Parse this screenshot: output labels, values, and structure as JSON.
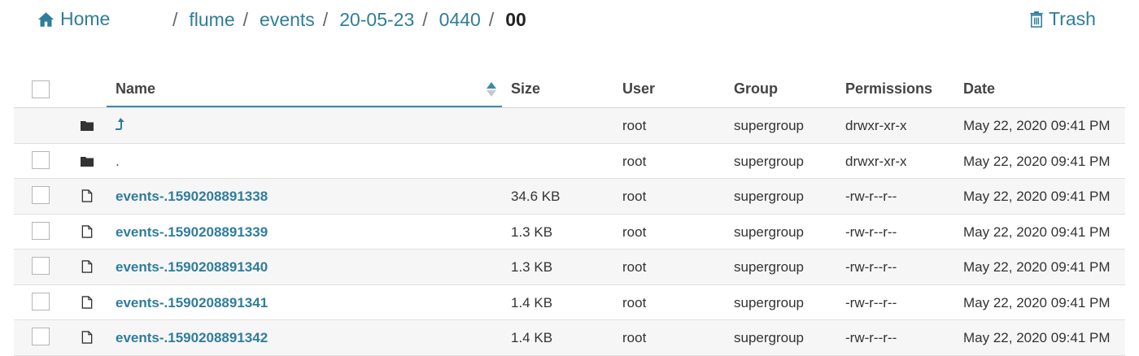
{
  "nav": {
    "home_label": "Home",
    "trash_label": "Trash",
    "breadcrumbs": [
      "flume",
      "events",
      "20-05-23",
      "0440",
      "00"
    ]
  },
  "table": {
    "headers": {
      "name": "Name",
      "size": "Size",
      "user": "User",
      "group": "Group",
      "permissions": "Permissions",
      "date": "Date"
    },
    "rows": [
      {
        "type": "parent",
        "name": "",
        "size": "",
        "user": "root",
        "group": "supergroup",
        "permissions": "drwxr-xr-x",
        "date": "May 22, 2020 09:41 PM"
      },
      {
        "type": "folder",
        "name": ".",
        "size": "",
        "user": "root",
        "group": "supergroup",
        "permissions": "drwxr-xr-x",
        "date": "May 22, 2020 09:41 PM"
      },
      {
        "type": "file",
        "name": "events-.1590208891338",
        "size": "34.6 KB",
        "user": "root",
        "group": "supergroup",
        "permissions": "-rw-r--r--",
        "date": "May 22, 2020 09:41 PM"
      },
      {
        "type": "file",
        "name": "events-.1590208891339",
        "size": "1.3 KB",
        "user": "root",
        "group": "supergroup",
        "permissions": "-rw-r--r--",
        "date": "May 22, 2020 09:41 PM"
      },
      {
        "type": "file",
        "name": "events-.1590208891340",
        "size": "1.3 KB",
        "user": "root",
        "group": "supergroup",
        "permissions": "-rw-r--r--",
        "date": "May 22, 2020 09:41 PM"
      },
      {
        "type": "file",
        "name": "events-.1590208891341",
        "size": "1.4 KB",
        "user": "root",
        "group": "supergroup",
        "permissions": "-rw-r--r--",
        "date": "May 22, 2020 09:41 PM"
      },
      {
        "type": "file",
        "name": "events-.1590208891342",
        "size": "1.4 KB",
        "user": "root",
        "group": "supergroup",
        "permissions": "-rw-r--r--",
        "date": "May 22, 2020 09:41 PM"
      }
    ]
  },
  "icons": {
    "home": "home-icon",
    "trash": "trash-icon",
    "folder": "folder-icon",
    "file": "file-icon",
    "parent": "level-up-icon",
    "sort": "sort-icon"
  },
  "colors": {
    "link": "#2f7d9c",
    "row_alt": "#f6f6f6",
    "underline": "#3c8bab"
  }
}
